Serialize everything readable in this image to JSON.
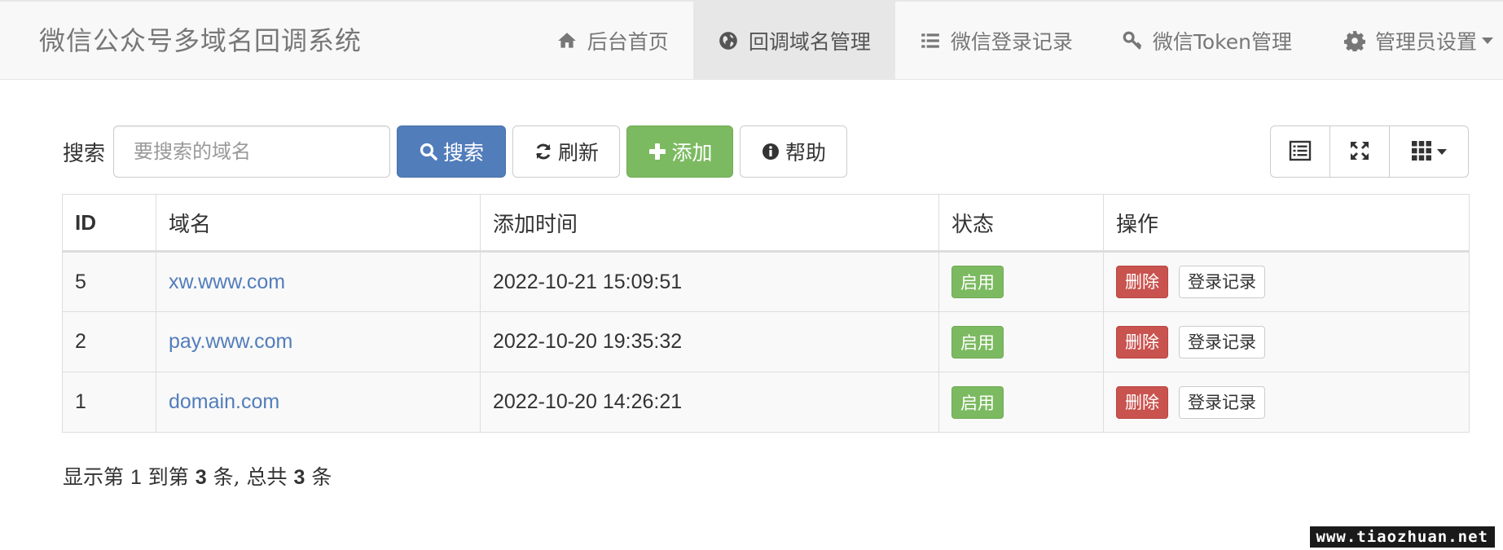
{
  "navbar": {
    "brand": "微信公众号多域名回调系统",
    "items": [
      {
        "label": "后台首页",
        "icon": "home-icon",
        "active": false
      },
      {
        "label": "回调域名管理",
        "icon": "globe-icon",
        "active": true
      },
      {
        "label": "微信登录记录",
        "icon": "list-icon",
        "active": false
      },
      {
        "label": "微信Token管理",
        "icon": "key-icon",
        "active": false
      },
      {
        "label": "管理员设置",
        "icon": "gear-icon",
        "active": false,
        "dropdown": true
      }
    ]
  },
  "toolbar": {
    "search_label": "搜索",
    "search_placeholder": "要搜索的域名",
    "search_value": "",
    "search_button": "搜索",
    "refresh_button": "刷新",
    "add_button": "添加",
    "help_button": "帮助",
    "view_buttons": [
      "list-view-icon",
      "fullscreen-icon",
      "columns-grid-icon"
    ]
  },
  "table": {
    "columns": [
      "ID",
      "域名",
      "添加时间",
      "状态",
      "操作"
    ],
    "rows": [
      {
        "id": "5",
        "domain": "xw.www.com",
        "added": "2022-10-21 15:09:51",
        "status": "启用",
        "delete": "删除",
        "log": "登录记录"
      },
      {
        "id": "2",
        "domain": "pay.www.com",
        "added": "2022-10-20 19:35:32",
        "status": "启用",
        "delete": "删除",
        "log": "登录记录"
      },
      {
        "id": "1",
        "domain": "domain.com",
        "added": "2022-10-20 14:26:21",
        "status": "启用",
        "delete": "删除",
        "log": "登录记录"
      }
    ]
  },
  "pagination": {
    "t1": "显示第 ",
    "from": "1",
    "t2": " 到第 ",
    "to": "3",
    "t3": " 条, 总共 ",
    "total": "3",
    "t4": " 条"
  },
  "watermark": "www.tiaozhuan.net",
  "colors": {
    "primary": "#527dbb",
    "success": "#7cba61",
    "danger": "#c9534f",
    "link": "#527dbb",
    "navbar_bg": "#f8f8f8",
    "navbar_active_bg": "#e7e7e7"
  }
}
